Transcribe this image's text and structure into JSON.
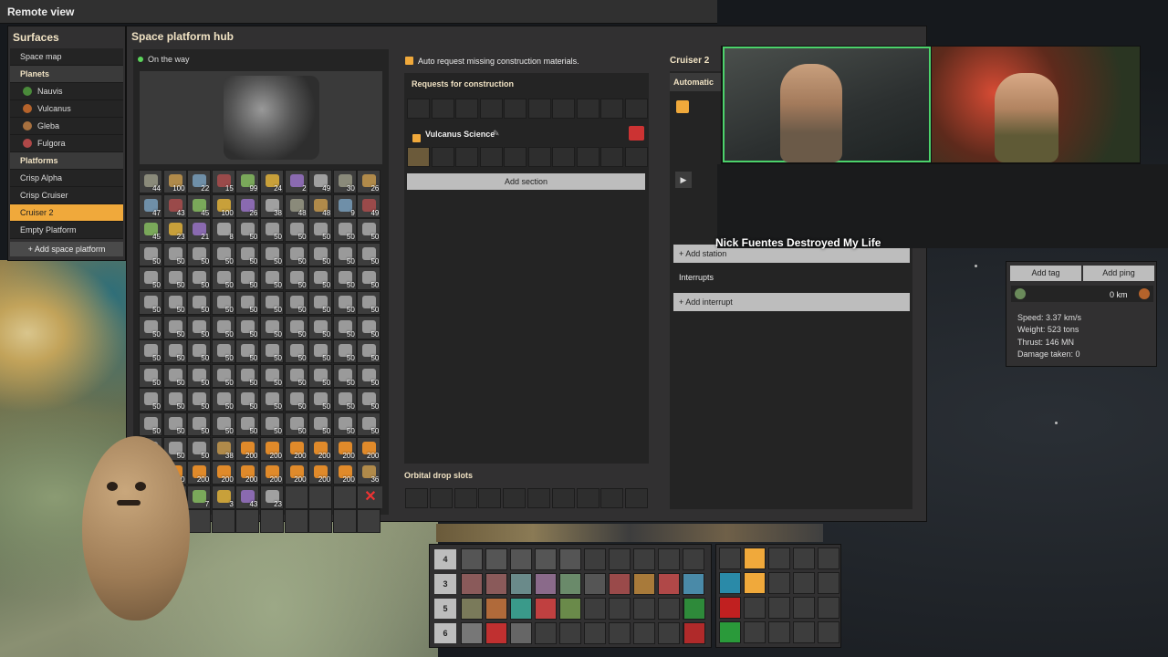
{
  "window": {
    "title": "Remote view"
  },
  "surfaces": {
    "title": "Surfaces",
    "space_map": "Space map",
    "planets_header": "Planets",
    "planets": [
      {
        "label": "Nauvis",
        "color": "#4a8a3a"
      },
      {
        "label": "Vulcanus",
        "color": "#b5632b"
      },
      {
        "label": "Gleba",
        "color": "#a8713f"
      },
      {
        "label": "Fulgora",
        "color": "#b04848"
      }
    ],
    "platforms_header": "Platforms",
    "platforms": [
      "Crisp Alpha",
      "Crisp Cruiser",
      "Cruiser 2",
      "Empty Platform"
    ],
    "selected_platform": "Cruiser 2",
    "add_platform": "+ Add space platform"
  },
  "hub": {
    "title": "Space platform hub",
    "status": "On the way",
    "inventory_counts": [
      [
        "44",
        "100",
        "22",
        "15",
        "99",
        "24",
        "2",
        "49",
        "30",
        "26"
      ],
      [
        "47",
        "43",
        "45",
        "100",
        "26",
        "38",
        "48",
        "48",
        "9",
        "49"
      ],
      [
        "45",
        "23",
        "21",
        "8",
        "50",
        "50",
        "50",
        "50",
        "50",
        "50"
      ],
      [
        "50",
        "50",
        "50",
        "50",
        "50",
        "50",
        "50",
        "50",
        "50",
        "50"
      ],
      [
        "50",
        "50",
        "50",
        "50",
        "50",
        "50",
        "50",
        "50",
        "50",
        "50"
      ],
      [
        "50",
        "50",
        "50",
        "50",
        "50",
        "50",
        "50",
        "50",
        "50",
        "50"
      ],
      [
        "50",
        "50",
        "50",
        "50",
        "50",
        "50",
        "50",
        "50",
        "50",
        "50"
      ],
      [
        "50",
        "50",
        "50",
        "50",
        "50",
        "50",
        "50",
        "50",
        "50",
        "50"
      ],
      [
        "50",
        "50",
        "50",
        "50",
        "50",
        "50",
        "50",
        "50",
        "50",
        "50"
      ],
      [
        "50",
        "50",
        "50",
        "50",
        "50",
        "50",
        "50",
        "50",
        "50",
        "50"
      ],
      [
        "50",
        "50",
        "50",
        "50",
        "50",
        "50",
        "50",
        "50",
        "50",
        "50"
      ],
      [
        "50",
        "50",
        "50",
        "38",
        "200",
        "200",
        "200",
        "200",
        "200",
        "200"
      ],
      [
        "",
        "200",
        "200",
        "200",
        "200",
        "200",
        "200",
        "200",
        "200",
        "36"
      ],
      [
        "",
        "",
        "7",
        "3",
        "43",
        "23",
        "",
        "",
        "",
        ""
      ],
      [
        "",
        "",
        "",
        "",
        "",
        "",
        "",
        "",
        "",
        ""
      ]
    ]
  },
  "requests": {
    "auto_request": "Auto request missing construction materials.",
    "title": "Requests for construction",
    "section_name": "Vulcanus Science",
    "add_section": "Add section",
    "orbital": "Orbital drop slots"
  },
  "cruiser": {
    "title": "Cruiser 2",
    "auto_tab": "Automatic",
    "add_station": "+ Add station",
    "interrupts": "Interrupts",
    "add_interrupt": "+ Add interrupt"
  },
  "tags": {
    "add_tag": "Add tag",
    "add_ping": "Add ping",
    "distance": "0 km",
    "speed": "Speed: 3.37 km/s",
    "weight": "Weight: 523 tons",
    "thrust": "Thrust: 146 MN",
    "damage": "Damage taken: 0"
  },
  "stream": {
    "caption": "Nick Fuentes Destroyed My Life"
  },
  "hotbar": {
    "rows": [
      "4",
      "3",
      "5",
      "6"
    ]
  }
}
